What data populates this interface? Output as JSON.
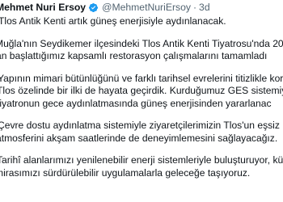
{
  "tweet": {
    "display_name": "Mehmet Nuri Ersoy",
    "handle": "@MehmetNuriErsoy",
    "separator": "·",
    "timestamp": "3d",
    "badge_icon": "verified-badge-icon",
    "badge_color": "#1d9bf0",
    "paragraphs": [
      [
        "Tlos Antik Kenti artık güneş enerjisiyle aydınlanacak."
      ],
      [
        "Muğla'nın Seydikemer ilçesindeki Tlos Antik Kenti Tiyatrosu'nda 20",
        "an başlattığımız kapsamlı restorasyon çalışmalarını tamamladı"
      ],
      [
        "Yapının mimari bütünlüğünü ve farklı tarihsel evrelerini titizlikle kor",
        "Tlos özelinde bir ilki de hayata geçirdik. Kurduğumuz GES sistemiyl",
        "tiyatronun gece aydınlatmasında güneş enerjisinden yararlanac"
      ],
      [
        "Çevre dostu aydınlatma sistemiyle ziyaretçilerimizin Tlos'un eşsiz",
        "atmosferini akşam saatlerinde de deneyimlemesini sağlayacağız."
      ],
      [
        "Tarihî alanlarımızı yenilenebilir enerji sistemleriyle buluşturuyor, kü",
        "mirasımızı sürdürülebilir uygulamalarla geleceğe taşıyoruz."
      ]
    ]
  }
}
